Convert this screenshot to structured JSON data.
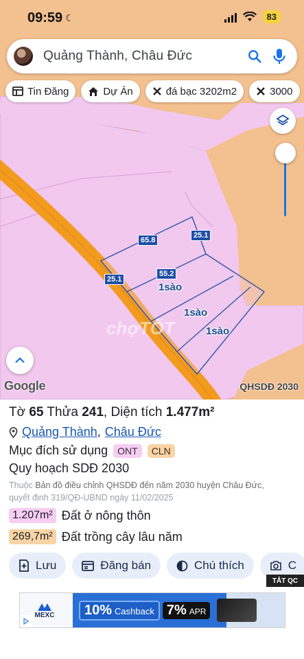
{
  "status_bar": {
    "time": "09:59",
    "battery": "83"
  },
  "search": {
    "query": "Quảng Thành, Châu Đức"
  },
  "chips": [
    {
      "label": "Tin Đăng"
    },
    {
      "label": "Dự Án"
    },
    {
      "label": "đá bạc 3202m2"
    },
    {
      "label": "3000"
    }
  ],
  "map": {
    "dimensions": [
      "65.8",
      "25.1",
      "55.2",
      "25.1"
    ],
    "plot_labels": [
      "1sào",
      "1sào",
      "1sào"
    ],
    "watermark": "chợTỐT",
    "google_logo": "Google",
    "layer_name": "QHSDĐ 2030",
    "colors": {
      "urban_land": "#f3c08f",
      "rural_residential": "#f2c8ee",
      "road": "#f29b1f",
      "parcel_line": "#2a56a8"
    }
  },
  "info": {
    "title_prefix": "Tờ ",
    "sheet": "65",
    "title_mid": " Thửa ",
    "parcel": "241",
    "title_area_label": ", Diện tích ",
    "area": "1.477m²",
    "commune": "Quảng Thành",
    "separator": ", ",
    "district": "Châu Đức",
    "purpose_label": "Mục đích sử dụng",
    "purpose_tags": [
      "ONT",
      "CLN"
    ],
    "plan_label": "Quy hoạch SDĐ 2030",
    "plan_desc_prefix": "Thuộc ",
    "plan_desc_line1": "Bản đồ điều chỉnh QHSDĐ đến năm 2030 huyện Châu Đức,",
    "plan_desc_line2": "quyết định 319/QĐ-UBND ngày 11/02/2025",
    "areas": [
      {
        "value": "1.207m²",
        "label": "Đất ở nông thôn"
      },
      {
        "value": "269,7m²",
        "label": "Đất trồng cây lâu năm"
      }
    ]
  },
  "actions": [
    {
      "label": "Lưu"
    },
    {
      "label": "Đăng bán"
    },
    {
      "label": "Chú thích"
    },
    {
      "label": "C"
    }
  ],
  "ad": {
    "close_label": "TẮT QC",
    "brand": "MEXC",
    "cashback_value": "10%",
    "cashback_label": "Cashback",
    "apr_value": "7%",
    "apr_label": "APR"
  }
}
